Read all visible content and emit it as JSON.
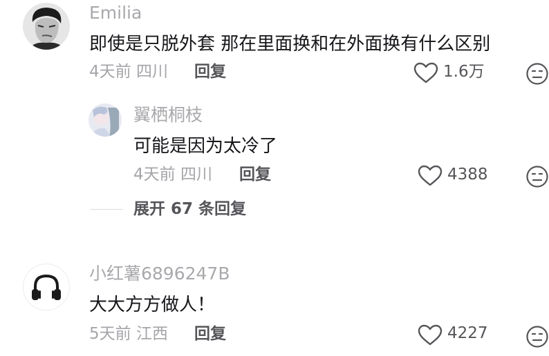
{
  "comments": [
    {
      "username": "Emilia",
      "text": "即使是只脱外套 那在里面换和在外面换有什么区别",
      "time": "4天前",
      "location": "四川",
      "reply_label": "回复",
      "likes": "1.6万",
      "replies": [
        {
          "username": "翼栖桐枝",
          "text": "可能是因为太冷了",
          "time": "4天前",
          "location": "四川",
          "reply_label": "回复",
          "likes": "4388"
        }
      ],
      "expand_label": "展开 67 条回复"
    },
    {
      "username": "小红薯6896247B",
      "text": "大大方方做人！",
      "time": "5天前",
      "location": "江西",
      "reply_label": "回复",
      "likes": "4227"
    }
  ],
  "icons": {
    "like": "heart-outline-icon",
    "dislike": "dislike-face-icon",
    "avatar2": "headphones-icon"
  },
  "colors": {
    "text_primary": "#16161a",
    "text_secondary": "#a5a5aa",
    "text_action": "#555559"
  }
}
